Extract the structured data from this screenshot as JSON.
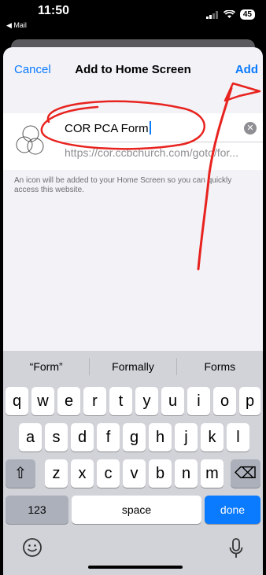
{
  "status": {
    "time": "11:50",
    "back_app": "◀ Mail",
    "battery": "45"
  },
  "navbar": {
    "cancel": "Cancel",
    "title": "Add to Home Screen",
    "add": "Add"
  },
  "form": {
    "name_value": "COR PCA Form",
    "url": "https://cor.ccbchurch.com/goto/for...",
    "hint": "An icon will be added to your Home Screen so you can quickly access this website."
  },
  "keyboard": {
    "suggestions": [
      "“Form”",
      "Formally",
      "Forms"
    ],
    "row1": [
      "q",
      "w",
      "e",
      "r",
      "t",
      "y",
      "u",
      "i",
      "o",
      "p"
    ],
    "row2": [
      "a",
      "s",
      "d",
      "f",
      "g",
      "h",
      "j",
      "k",
      "l"
    ],
    "row3": [
      "z",
      "x",
      "c",
      "v",
      "b",
      "n",
      "m"
    ],
    "shift": "⇧",
    "delete": "⌫",
    "numbers": "123",
    "space": "space",
    "done": "done"
  },
  "colors": {
    "accent": "#0a7aff",
    "annotation": "#e8231f"
  }
}
